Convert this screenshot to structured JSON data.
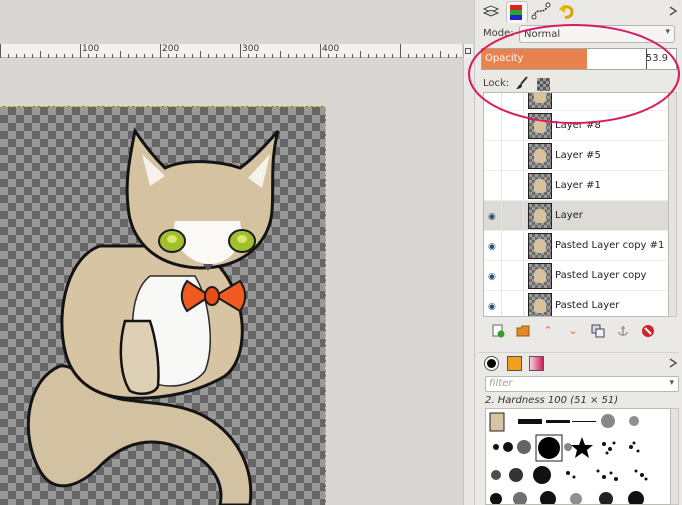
{
  "ruler": {
    "labels": [
      "100",
      "200",
      "300",
      "400"
    ]
  },
  "dock": {
    "tabs": [
      "layers-tab",
      "channels-tab",
      "paths-tab",
      "undo-history-tab"
    ],
    "mode_label": "Mode:",
    "mode_value": "Normal",
    "opacity_label": "Opacity",
    "opacity_value": "53.9",
    "opacity_fraction": 0.539,
    "lock_label": "Lock:"
  },
  "layers": [
    {
      "name": "",
      "visible": false,
      "selected": false
    },
    {
      "name": "Layer #8",
      "visible": false,
      "selected": false
    },
    {
      "name": "Layer #5",
      "visible": false,
      "selected": false
    },
    {
      "name": "Layer #1",
      "visible": false,
      "selected": false
    },
    {
      "name": "Layer",
      "visible": true,
      "selected": true
    },
    {
      "name": "Pasted Layer copy #1",
      "visible": true,
      "selected": false
    },
    {
      "name": "Pasted Layer copy",
      "visible": true,
      "selected": false
    },
    {
      "name": "Pasted Layer",
      "visible": true,
      "selected": false
    }
  ],
  "brushes": {
    "filter_placeholder": "filter",
    "selected_brush": "2. Hardness 100 (51 × 51)"
  },
  "colors": {
    "opacity_fill": "#e8824f",
    "highlight": "#d81b60",
    "accent_blue": "#2b4a6b"
  }
}
